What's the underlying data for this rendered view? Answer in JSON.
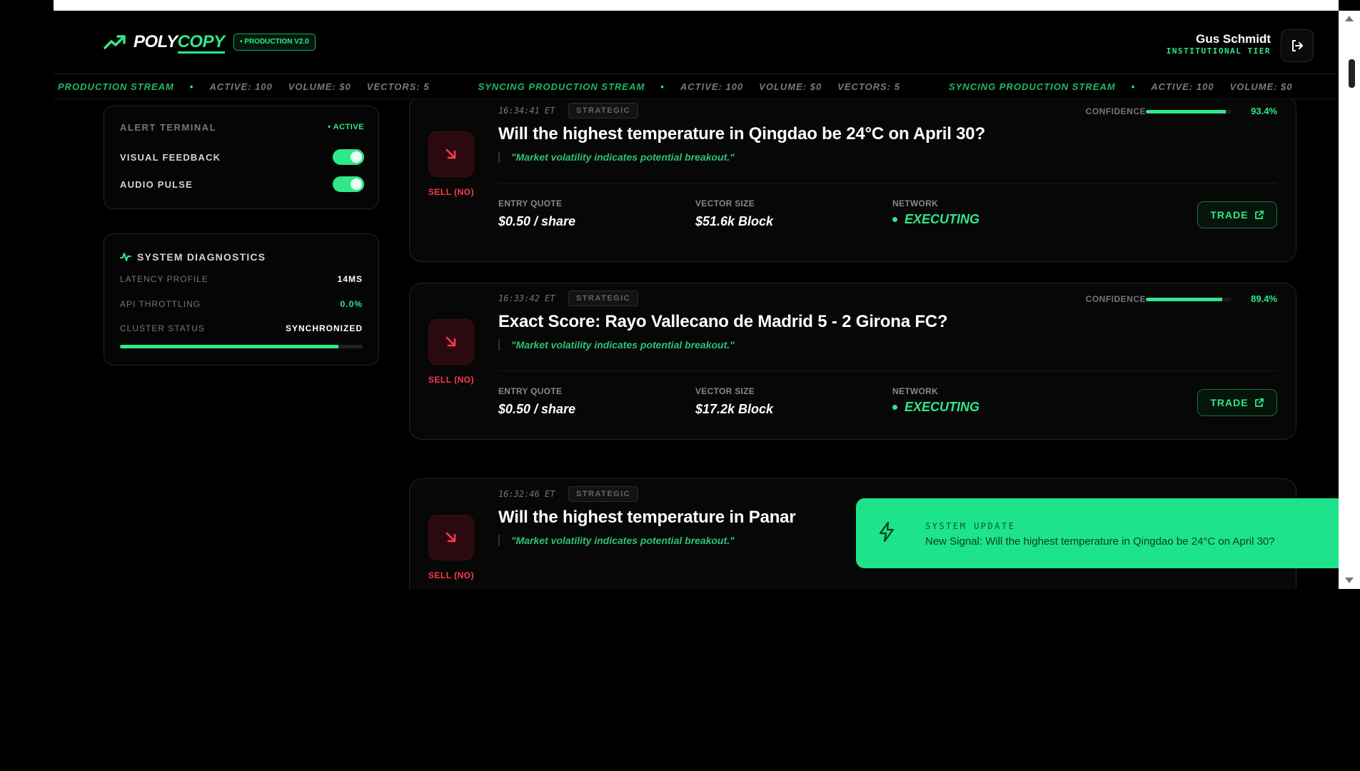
{
  "app": {
    "brand_part1": "POLY",
    "brand_part2": "COPY",
    "env_badge": "• PRODUCTION V2.0"
  },
  "user": {
    "name": "Gus Schmidt",
    "tier": "INSTITUTIONAL TIER"
  },
  "ticker": [
    {
      "stream": "PRODUCTION STREAM",
      "active": "ACTIVE: 100",
      "volume": "VOLUME: $0",
      "vectors": "VECTORS: 5"
    },
    {
      "stream": "SYNCING PRODUCTION STREAM",
      "active": "ACTIVE: 100",
      "volume": "VOLUME: $0",
      "vectors": "VECTORS: 5"
    },
    {
      "stream": "SYNCING PRODUCTION STREAM",
      "active": "ACTIVE: 100",
      "volume": "VOLUME: $0"
    }
  ],
  "alert_terminal": {
    "title": "ALERT TERMINAL",
    "status": "• ACTIVE",
    "toggles": [
      {
        "label": "VISUAL FEEDBACK",
        "on": true
      },
      {
        "label": "AUDIO PULSE",
        "on": true
      }
    ]
  },
  "diagnostics": {
    "title": "SYSTEM DIAGNOSTICS",
    "rows": [
      {
        "label": "LATENCY PROFILE",
        "value": "14MS"
      },
      {
        "label": "API THROTTLING",
        "value": "0.0%"
      },
      {
        "label": "CLUSTER STATUS",
        "value": "SYNCHRONIZED"
      }
    ],
    "health_fraction": 0.9
  },
  "signals": [
    {
      "time": "16:34:41 ET",
      "tag": "STRATEGIC",
      "confidence_label": "CONFIDENCE",
      "confidence": "93.4%",
      "confidence_fraction": 0.934,
      "title": "Will the highest temperature in Qingdao be 24°C on April 30?",
      "quote": "\"Market volatility indicates potential breakout.\"",
      "direction": "SELL (NO)",
      "entry_label": "ENTRY QUOTE",
      "entry": "$0.50 / share",
      "size_label": "VECTOR SIZE",
      "size": "$51.6k Block",
      "network_label": "NETWORK",
      "network": "EXECUTING",
      "trade_label": "TRADE"
    },
    {
      "time": "16:33:42 ET",
      "tag": "STRATEGIC",
      "confidence_label": "CONFIDENCE",
      "confidence": "89.4%",
      "confidence_fraction": 0.894,
      "title": "Exact Score: Rayo Vallecano de Madrid 5 - 2 Girona FC?",
      "quote": "\"Market volatility indicates potential breakout.\"",
      "direction": "SELL (NO)",
      "entry_label": "ENTRY QUOTE",
      "entry": "$0.50 / share",
      "size_label": "VECTOR SIZE",
      "size": "$17.2k Block",
      "network_label": "NETWORK",
      "network": "EXECUTING",
      "trade_label": "TRADE"
    },
    {
      "time": "16:32:46 ET",
      "tag": "STRATEGIC",
      "title": "Will the highest temperature in Panar",
      "quote": "\"Market volatility indicates potential breakout.\"",
      "direction": "SELL (NO)"
    }
  ],
  "toast": {
    "title": "SYSTEM UPDATE",
    "message": "New Signal: Will the highest temperature in Qingdao be 24°C on April 30?"
  },
  "colors": {
    "accent": "#2ee88a",
    "sell": "#ff3b4e",
    "toast_bg": "#1de48a"
  }
}
